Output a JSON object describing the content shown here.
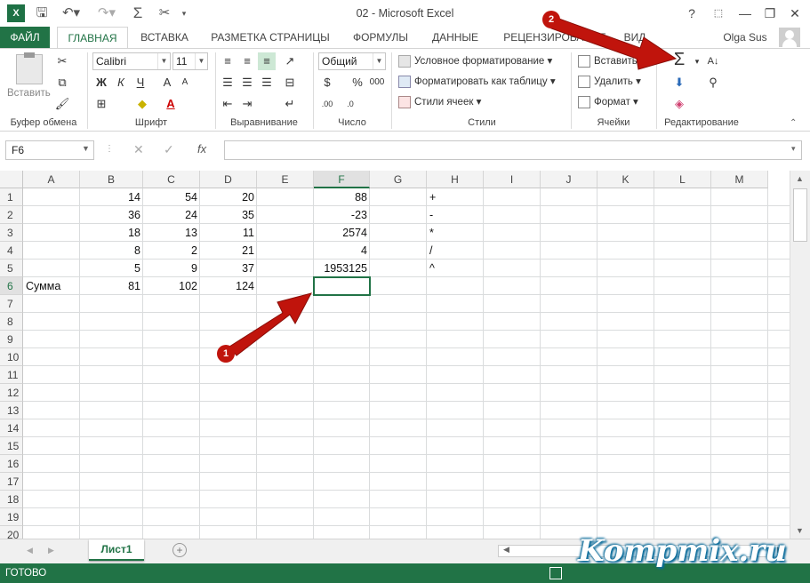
{
  "window": {
    "title": "02 - Microsoft Excel",
    "help": "?",
    "minimize": "—",
    "restore": "❐",
    "close": "✕"
  },
  "tabs": {
    "file": "ФАЙЛ",
    "home": "ГЛАВНАЯ",
    "insert": "ВСТАВКА",
    "layout": "РАЗМЕТКА СТРАНИЦЫ",
    "formulas": "ФОРМУЛЫ",
    "data": "ДАННЫЕ",
    "review": "РЕЦЕНЗИРОВАНИЕ",
    "view": "ВИД",
    "user": "Olga Sus"
  },
  "ribbon": {
    "paste": "Вставить",
    "font_name": "Calibri",
    "font_size": "11",
    "bold": "Ж",
    "italic": "К",
    "underline": "Ч",
    "number_format": "Общий",
    "cond_format": "Условное форматирование",
    "format_table": "Форматировать как таблицу",
    "cell_styles": "Стили ячеек",
    "insert": "Вставить",
    "delete": "Удалить",
    "format": "Формат",
    "groups": {
      "clipboard": "Буфер обмена",
      "font": "Шрифт",
      "alignment": "Выравнивание",
      "number": "Число",
      "styles": "Стили",
      "cells": "Ячейки",
      "editing": "Редактирование"
    }
  },
  "formula_bar": {
    "name_box": "F6",
    "fx": "fx",
    "value": ""
  },
  "columns": [
    "A",
    "B",
    "C",
    "D",
    "E",
    "F",
    "G",
    "H",
    "I",
    "J",
    "K",
    "L",
    "M"
  ],
  "rows": [
    "1",
    "2",
    "3",
    "4",
    "5",
    "6",
    "7",
    "8",
    "9",
    "10",
    "11",
    "12",
    "13",
    "14",
    "15",
    "16",
    "17",
    "18",
    "19",
    "20"
  ],
  "cells": {
    "B1": "14",
    "C1": "54",
    "D1": "20",
    "F1": "88",
    "H1": "+",
    "B2": "36",
    "C2": "24",
    "D2": "35",
    "F2": "-23",
    "H2": "-",
    "B3": "18",
    "C3": "13",
    "D3": "11",
    "F3": "2574",
    "H3": "*",
    "B4": "8",
    "C4": "2",
    "D4": "21",
    "F4": "4",
    "H4": "/",
    "B5": "5",
    "C5": "9",
    "D5": "37",
    "F5": "1953125",
    "H5": "^",
    "A6": "Сумма",
    "B6": "81",
    "C6": "102",
    "D6": "124"
  },
  "selected_cell": "F6",
  "sheet_tab": "Лист1",
  "status": "ГОТОВО",
  "annotations": {
    "arrow1": "1",
    "arrow2": "2"
  },
  "watermark": "Kompmix.ru",
  "colors": {
    "accent": "#217346",
    "arrow": "#c0140c"
  }
}
